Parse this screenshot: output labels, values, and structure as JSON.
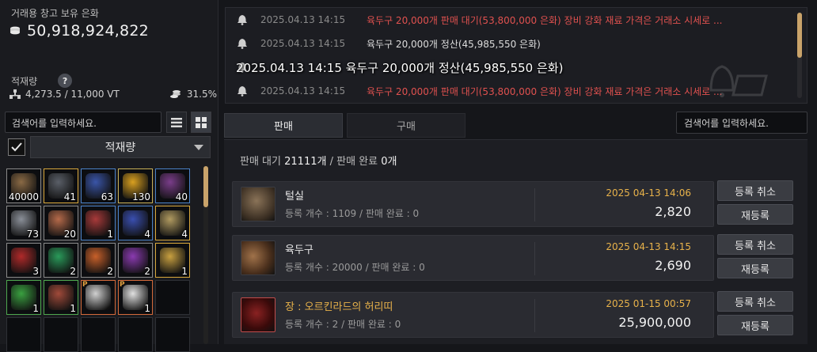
{
  "warehouse": {
    "title": "거래용 창고 보유 은화",
    "silver": "50,918,924,822",
    "capacity_label": "적재량",
    "help": "?",
    "weight": "4,273.5 / 11,000 VT",
    "weight_percent": "31.5%"
  },
  "left_search": {
    "placeholder": "검색어를 입력하세요."
  },
  "filter": {
    "selected": "적재량"
  },
  "inventory": [
    {
      "count": "40000",
      "color": "#8a6a45",
      "border": "w"
    },
    {
      "count": "41",
      "color": "#5a5f68",
      "border": "y"
    },
    {
      "count": "63",
      "color": "#3a55a8",
      "border": "b"
    },
    {
      "count": "130",
      "color": "#d9a020",
      "border": "g"
    },
    {
      "count": "40",
      "color": "#7a3d8a",
      "border": "b"
    },
    {
      "count": "73",
      "color": "#8a8f98",
      "border": "w"
    },
    {
      "count": "20",
      "color": "#b56a4a",
      "border": "w"
    },
    {
      "count": "1",
      "color": "#a83a3a",
      "border": "b"
    },
    {
      "count": "4",
      "color": "#3a4fb0",
      "border": "b"
    },
    {
      "count": "4",
      "color": "#b09a60",
      "border": "y"
    },
    {
      "count": "3",
      "color": "#b02a2a",
      "border": "w"
    },
    {
      "count": "2",
      "color": "#2a9a5a",
      "border": "w"
    },
    {
      "count": "2",
      "color": "#c8602a",
      "border": "w"
    },
    {
      "count": "2",
      "color": "#8a3ab0",
      "border": "w"
    },
    {
      "count": "1",
      "color": "#c8a040",
      "border": "y"
    },
    {
      "count": "1",
      "color": "#3aa040",
      "border": "gr"
    },
    {
      "count": "1",
      "color": "#a04a3a",
      "border": "gr"
    },
    {
      "count": "",
      "p": "P",
      "color": "#d0d0d0",
      "border": "o"
    },
    {
      "count": "1",
      "p": "P",
      "color": "#e0e0e0",
      "border": "o"
    },
    {
      "count": "",
      "color": "",
      "border": ""
    },
    {
      "count": "",
      "color": "",
      "border": ""
    },
    {
      "count": "",
      "color": "",
      "border": ""
    },
    {
      "count": "",
      "color": "",
      "border": ""
    },
    {
      "count": "",
      "color": "",
      "border": ""
    },
    {
      "count": "",
      "color": "",
      "border": ""
    }
  ],
  "notices": [
    {
      "time": "2025.04.13 14:15",
      "msg": "육두구 20,000개 판매 대기(53,800,000 은화) 장비 강화 재료 가격은 거래소 시세로 ...",
      "red": true
    },
    {
      "time": "2025.04.13 14:15",
      "msg": "육두구 20,000개 정산(45,985,550 은화)",
      "red": false
    },
    {
      "time": "",
      "msg": "",
      "red": false
    },
    {
      "time": "2025.04.13 14:15",
      "msg": "육두구 20,000개 판매 대기(53,800,000 은화) 장비 강화 재료 가격은 거래소 시세로 ...",
      "red": true
    }
  ],
  "overlay_text": "2025.04.13 14:15 육두구 20,000개 정산(45,985,550 은화)",
  "tabs": {
    "sell": "판매",
    "buy": "구매"
  },
  "right_search": {
    "placeholder": "검색어를 입력하세요."
  },
  "summary": {
    "pending_label": "판매 대기",
    "pending_value": "21111개",
    "sep": "/",
    "done_label": "판매 완료",
    "done_value": "0개"
  },
  "listings": [
    {
      "name": "털실",
      "sub": "등록 개수 : 1109 / 판매 완료 : 0",
      "date": "2025 04-13 14:06",
      "price": "2,820",
      "cancel": "등록 취소",
      "relist": "재등록",
      "gold": false
    },
    {
      "name": "육두구",
      "sub": "등록 개수 : 20000 / 판매 완료 : 0",
      "date": "2025 04-13 14:15",
      "price": "2,690",
      "cancel": "등록 취소",
      "relist": "재등록",
      "gold": false
    },
    {
      "name": "장 : 오르킨라드의 허리띠",
      "sub": "등록 개수 : 2 / 판매 완료 : 0",
      "date": "2025 01-15 00:57",
      "price": "25,900,000",
      "cancel": "등록 취소",
      "relist": "재등록",
      "gold": true
    }
  ]
}
